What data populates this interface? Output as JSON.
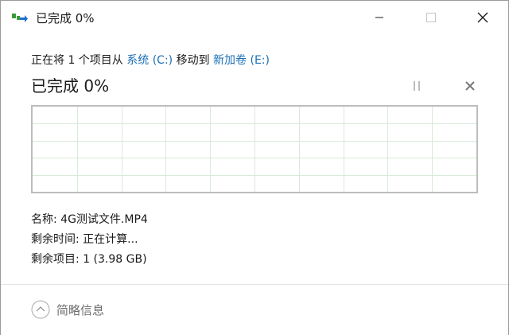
{
  "window": {
    "title": "已完成 0%",
    "controls": {
      "minimize": "minimize-icon",
      "maximize": "maximize-icon",
      "close": "close-icon"
    }
  },
  "operation": {
    "prefix": "正在将 1 个项目从 ",
    "source": "系统 (C:)",
    "middle": " 移动到 ",
    "destination": "新加卷 (E:)"
  },
  "progress": {
    "heading": "已完成 0%",
    "percent": 0,
    "pause_icon": "pause-icon",
    "cancel_icon": "cancel-icon"
  },
  "details": {
    "name_label": "名称: ",
    "name_value": "4G测试文件.MP4",
    "time_label": "剩余时间: ",
    "time_value": "正在计算...",
    "items_label": "剩余项目: ",
    "items_value": "1 (3.98 GB)"
  },
  "footer": {
    "toggle_label": "简略信息",
    "toggle_icon": "chevron-up-circle-icon"
  },
  "colors": {
    "link": "#1a6fb5",
    "graph_grid": "#d8ead9",
    "graph_border": "#bdbdbd"
  }
}
